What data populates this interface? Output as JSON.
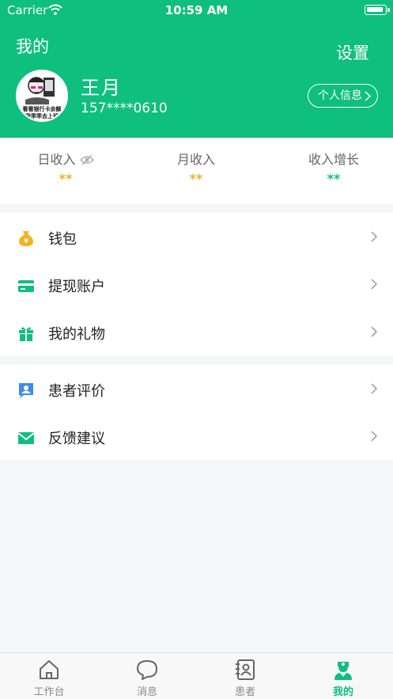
{
  "status_bar": {
    "carrier": "Carrier",
    "time": "10:59 AM"
  },
  "header": {
    "title": "我的",
    "settings_label": "设置",
    "profile_button": "个人信息"
  },
  "user": {
    "name": "王月",
    "phone": "157****0610",
    "avatar_caption_1": "看看银行卡余额",
    "avatar_caption_2": "我乖乖去上班"
  },
  "income": [
    {
      "label": "日收入",
      "value": "**"
    },
    {
      "label": "月收入",
      "value": "**"
    },
    {
      "label": "收入增长",
      "value": "**"
    }
  ],
  "menu_group_1": [
    {
      "label": "钱包",
      "icon": "wallet-icon"
    },
    {
      "label": "提现账户",
      "icon": "card-icon"
    },
    {
      "label": "我的礼物",
      "icon": "gift-icon"
    }
  ],
  "menu_group_2": [
    {
      "label": "患者评价",
      "icon": "review-icon"
    },
    {
      "label": "反馈建议",
      "icon": "mail-icon"
    }
  ],
  "tabs": [
    {
      "label": "工作台",
      "icon": "home-icon"
    },
    {
      "label": "消息",
      "icon": "message-icon"
    },
    {
      "label": "患者",
      "icon": "patient-icon"
    },
    {
      "label": "我的",
      "icon": "nurse-icon",
      "active": true
    }
  ],
  "colors": {
    "brand": "#0fbf7e",
    "income_gold": "#e8b32a",
    "income_green": "#0fbf7e",
    "icon_blue": "#3b8bf0",
    "icon_gold": "#f2b321"
  }
}
